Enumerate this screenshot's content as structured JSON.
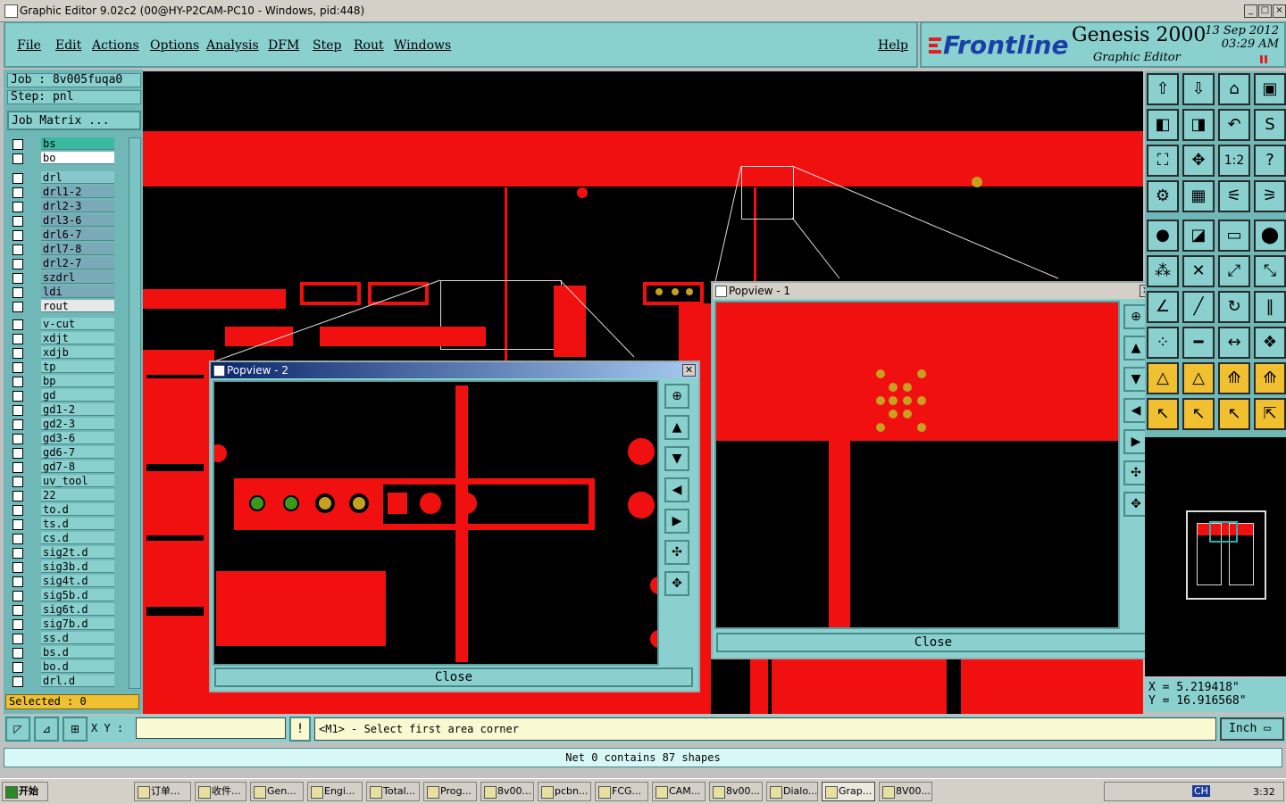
{
  "window": {
    "title": "Graphic Editor 9.02c2 (00@HY-P2CAM-PC10 - Windows, pid:448)",
    "min": "_",
    "max": "□",
    "close": "×"
  },
  "menu": {
    "items": [
      "File",
      "Edit",
      "Actions",
      "Options",
      "Analysis",
      "DFM",
      "Step",
      "Rout",
      "Windows"
    ],
    "help": "Help"
  },
  "brand": {
    "logo": "Frontline",
    "product": "Genesis 2000",
    "subtitle": "Graphic Editor",
    "date_line1": "13 Sep 2012",
    "date_line2": "03:29 AM"
  },
  "job": {
    "job_line": "Job : 8v005fuqa0",
    "step_line": "Step: pnl",
    "matrix_button": "Job Matrix ..."
  },
  "layers_top": [
    "bs",
    "bo"
  ],
  "layers_drill": [
    "drl",
    "drl1-2",
    "drl2-3",
    "drl3-6",
    "drl6-7",
    "drl7-8",
    "drl2-7",
    "szdrl",
    "ldi",
    "rout"
  ],
  "layers_bottom": [
    "v-cut",
    "xdjt",
    "xdjb",
    "tp",
    "bp",
    "gd",
    "gd1-2",
    "gd2-3",
    "gd3-6",
    "gd6-7",
    "gd7-8",
    "uv_tool",
    "22",
    "to.d",
    "ts.d",
    "cs.d",
    "sig2t.d",
    "sig3b.d",
    "sig4t.d",
    "sig5b.d",
    "sig6t.d",
    "sig7b.d",
    "ss.d",
    "bs.d",
    "bo.d",
    "drl.d"
  ],
  "selected": "Selected : 0",
  "popview1": {
    "title": "Popview - 1",
    "close": "Close"
  },
  "popview2": {
    "title": "Popview - 2",
    "close": "Close"
  },
  "coords": {
    "x": "X  =  5.219418\"",
    "y": "Y  =  16.916568\""
  },
  "cmd": {
    "xy_label": "X Y :",
    "xy_value": "",
    "prompt": "<M1> - Select first area corner",
    "units": "Inch"
  },
  "status": "Net 0 contains 87 shapes",
  "taskbar": {
    "start": "开始",
    "items": [
      "订单...",
      "收件...",
      "Gen...",
      "Engi...",
      "Total...",
      "Prog...",
      "8v00...",
      "pcbn...",
      "FCG...",
      "CAM...",
      "8v00...",
      "Dialo...",
      "Grap...",
      "8V00..."
    ],
    "clock": "3:32",
    "lang": "CH"
  },
  "colors": {
    "copper": "#f01010",
    "pad": "#c8a020",
    "panel": "#89d0cf",
    "accent": "#f0c030"
  }
}
